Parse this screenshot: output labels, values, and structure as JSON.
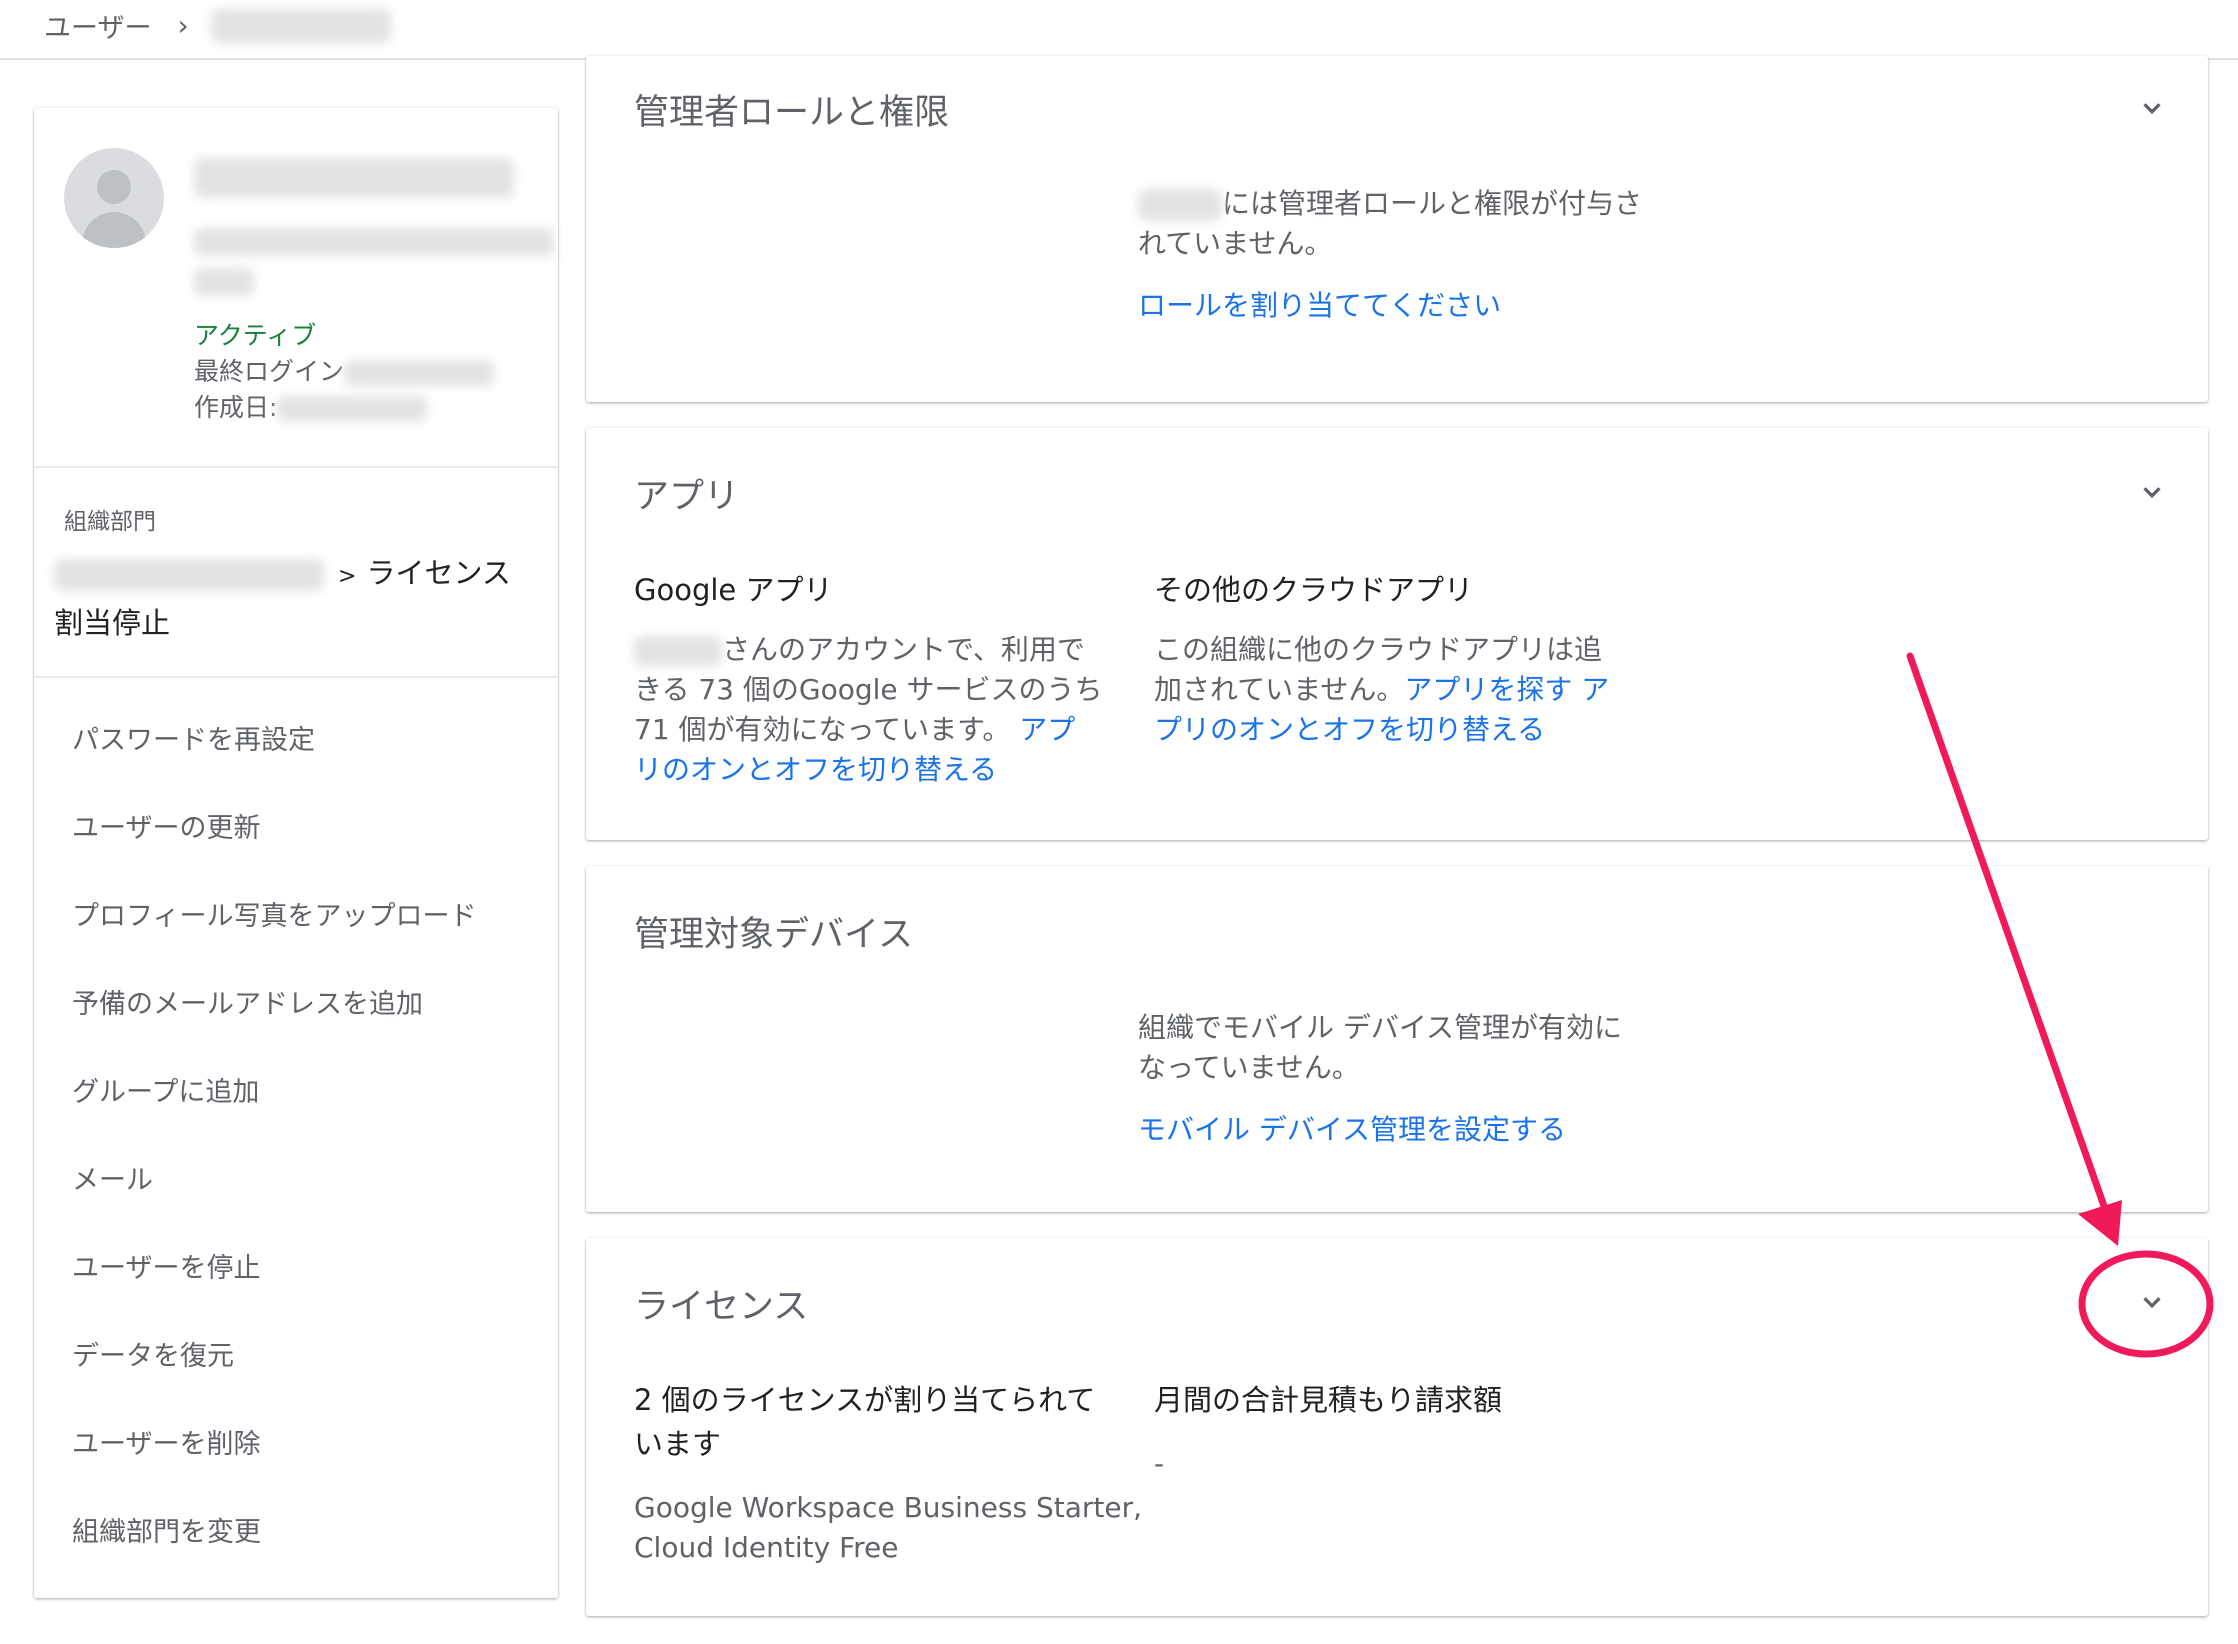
{
  "breadcrumb": {
    "root": "ユーザー",
    "separator": "›"
  },
  "user": {
    "status": "アクティブ",
    "last_login_label": "最終ログイン",
    "created_label": "作成日:"
  },
  "org": {
    "label": "組織部門",
    "path_current": "ライセンス割当停止"
  },
  "actions": [
    "パスワードを再設定",
    "ユーザーの更新",
    "プロフィール写真をアップロード",
    "予備のメールアドレスを追加",
    "グループに追加",
    "メール",
    "ユーザーを停止",
    "データを復元",
    "ユーザーを削除",
    "組織部門を変更"
  ],
  "admin_roles": {
    "title": "管理者ロールと権限",
    "message_part1": "には管理者ロールと権限が付与さ",
    "message_part2": "れていません。",
    "link": "ロールを割り当ててください"
  },
  "apps": {
    "title": "アプリ",
    "google": {
      "title": "Google アプリ",
      "text_a": "さんのアカウントで、利用で",
      "text_b": "きる 73 個のGoogle サービスのうち",
      "text_c": "71 個が有効になっています。",
      "link_a": "アプ",
      "link_b": "リのオンとオフを切り替える"
    },
    "other": {
      "title": "その他のクラウドアプリ",
      "text_a": "この組織に他のクラウドアプリは追",
      "text_b": "加されていません。",
      "link_a": "アプリを探す",
      "link_b": "ア",
      "link_c": "プリのオンとオフを切り替える"
    }
  },
  "devices": {
    "title": "管理対象デバイス",
    "message_a": "組織でモバイル デバイス管理が有効に",
    "message_b": "なっていません。",
    "link": "モバイル デバイス管理を設定する"
  },
  "licenses": {
    "title": "ライセンス",
    "assigned_a": "2 個のライセンスが割り当てられて",
    "assigned_b": "います",
    "products_a": "Google Workspace Business Starter,",
    "products_b": "Cloud Identity Free",
    "monthly_title": "月間の合計見積もり請求額",
    "monthly_value": "-"
  },
  "colors": {
    "accent_link": "#1a73e8",
    "active_green": "#188038",
    "annotation": "#f0195a"
  }
}
